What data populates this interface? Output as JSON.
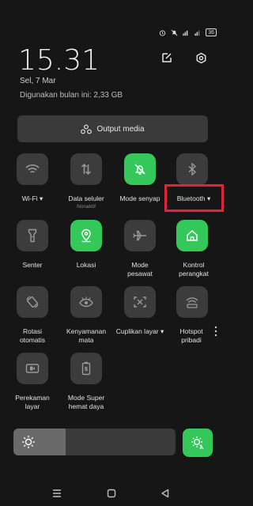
{
  "status": {
    "battery": "36"
  },
  "header": {
    "time": "15.31",
    "date": "Sel, 7 Mar",
    "usage": "Digunakan bulan ini: 2,33 GB"
  },
  "output_media": {
    "label": "Output media"
  },
  "tiles": [
    {
      "id": "wifi",
      "label": "Wi-Fi ▾",
      "active": false,
      "icon": "wifi-icon"
    },
    {
      "id": "mobile-data",
      "label": "Data seluler",
      "sublabel": "Nonaktif",
      "active": false,
      "icon": "data-arrows-icon"
    },
    {
      "id": "silent",
      "label": "Mode senyap",
      "active": true,
      "icon": "bell-off-icon"
    },
    {
      "id": "bluetooth",
      "label": "Bluetooth ▾",
      "active": false,
      "icon": "bluetooth-icon"
    },
    {
      "id": "flashlight",
      "label": "Senter",
      "active": false,
      "icon": "flashlight-icon"
    },
    {
      "id": "location",
      "label": "Lokasi",
      "active": true,
      "icon": "location-icon"
    },
    {
      "id": "airplane",
      "label": "Mode\npesawat",
      "active": false,
      "icon": "airplane-icon"
    },
    {
      "id": "device-control",
      "label": "Kontrol\nperangkat",
      "active": true,
      "icon": "home-icon"
    },
    {
      "id": "auto-rotate",
      "label": "Rotasi\notomatis",
      "active": false,
      "icon": "rotate-icon"
    },
    {
      "id": "eye-comfort",
      "label": "Kenyamanan\nmata",
      "active": false,
      "icon": "eye-icon"
    },
    {
      "id": "screenshot",
      "label": "Cuplikan layar ▾",
      "active": false,
      "icon": "screenshot-icon"
    },
    {
      "id": "hotspot",
      "label": "Hotspot\npribadi",
      "active": false,
      "icon": "hotspot-icon"
    },
    {
      "id": "screen-record",
      "label": "Perekaman\nlayar",
      "active": false,
      "icon": "record-icon"
    },
    {
      "id": "super-saver",
      "label": "Mode Super\nhemat daya",
      "active": false,
      "icon": "battery-saver-icon"
    }
  ],
  "brightness": {
    "level": 0.32
  },
  "colors": {
    "accent": "#34c759",
    "highlight": "#e0243a",
    "tile": "#3c3c3c"
  }
}
